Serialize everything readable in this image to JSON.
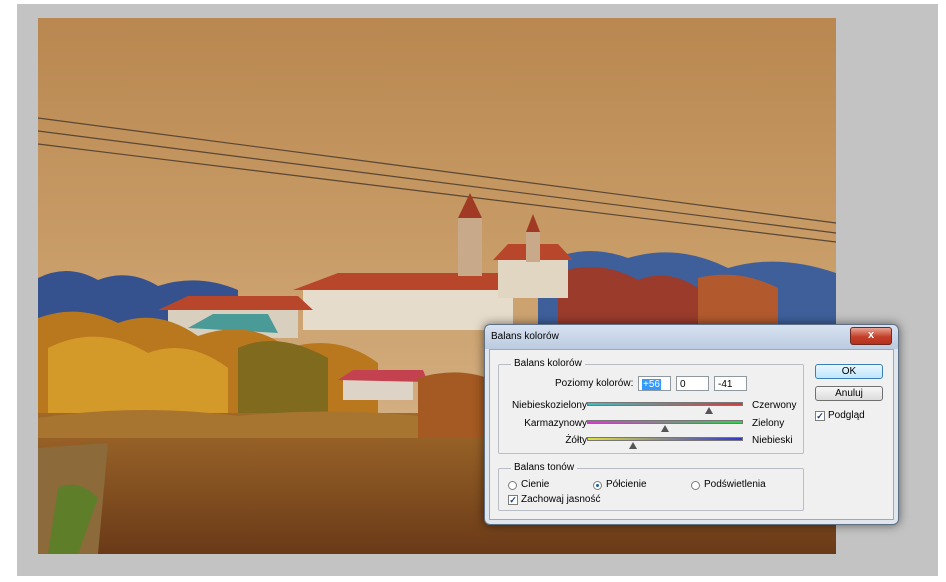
{
  "dialog": {
    "title": "Balans kolorów",
    "close_label": "x",
    "color_balance": {
      "group_label": "Balans kolorów",
      "levels_label": "Poziomy kolorów:",
      "levels": [
        "+56",
        "0",
        "-41"
      ],
      "sliders": [
        {
          "left": "Niebieskozielony",
          "right": "Czerwony",
          "value": 56,
          "gradient": [
            "#3bbfc4",
            "#d43a3a"
          ]
        },
        {
          "left": "Karmazynowy",
          "right": "Zielony",
          "value": 0,
          "gradient": [
            "#d93bd0",
            "#2fd24a"
          ]
        },
        {
          "left": "Żółty",
          "right": "Niebieski",
          "value": -41,
          "gradient": [
            "#e1e23a",
            "#2f35d6"
          ]
        }
      ]
    },
    "tone_balance": {
      "group_label": "Balans tonów",
      "options": [
        "Cienie",
        "Półcienie",
        "Podświetlenia"
      ],
      "selected": "Półcienie",
      "preserve_label": "Zachowaj jasność",
      "preserve_checked": true
    },
    "buttons": {
      "ok": "OK",
      "cancel": "Anuluj"
    },
    "preview_label": "Podgląd",
    "preview_checked": true
  },
  "colors": {
    "workspace": "#c3c3c3",
    "sky": "#c89a62",
    "roof": "#b8462b"
  }
}
